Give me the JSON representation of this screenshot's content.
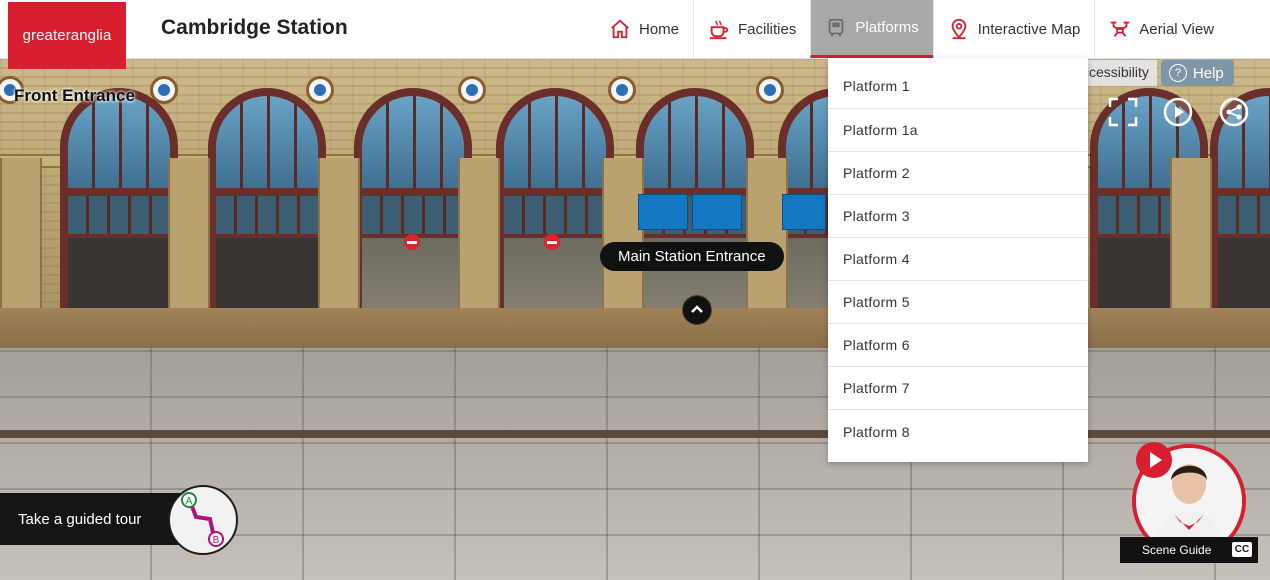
{
  "brand": {
    "logo_text": "greateranglia",
    "color": "#d71f30"
  },
  "header": {
    "title": "Cambridge Station",
    "nav": [
      {
        "label": "Home",
        "icon": "home-icon"
      },
      {
        "label": "Facilities",
        "icon": "coffee-cup-icon"
      },
      {
        "label": "Platforms",
        "icon": "train-icon",
        "active": true
      },
      {
        "label": "Interactive Map",
        "icon": "map-pin-icon"
      },
      {
        "label": "Aerial View",
        "icon": "drone-icon"
      }
    ]
  },
  "dropdown": {
    "items": [
      "Platform 1",
      "Platform 1a",
      "Platform 2",
      "Platform 3",
      "Platform 4",
      "Platform 5",
      "Platform 6",
      "Platform 7",
      "Platform 8"
    ]
  },
  "scene": {
    "label": "Front Entrance",
    "hotspot_label": "Main Station Entrance"
  },
  "utilities": {
    "accessibility": "ccessibility",
    "help": "Help"
  },
  "tour": {
    "label": "Take a guided tour"
  },
  "guide": {
    "caption": "Scene Guide",
    "cc": "CC"
  }
}
